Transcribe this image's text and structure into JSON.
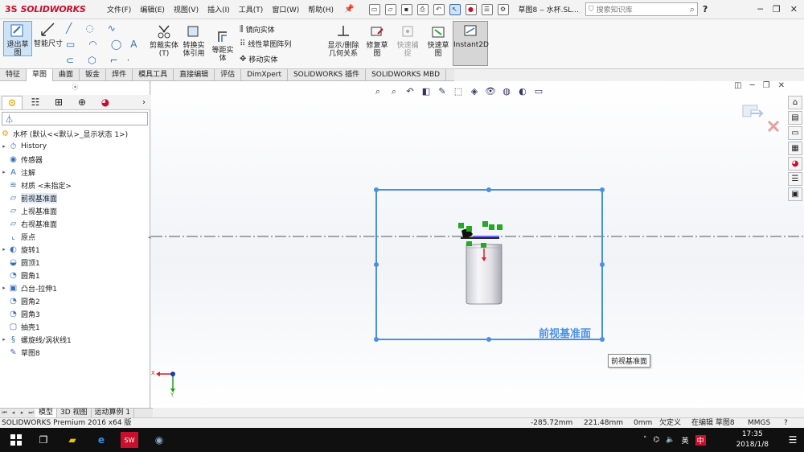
{
  "app": {
    "logo_ds": "3S",
    "logo_text": "SOLIDWORKS",
    "doc_title": "草图8 ‒ 水杯.SL...",
    "window_controls": [
      "─",
      "❐",
      "✕"
    ]
  },
  "menu": [
    "文件(F)",
    "编辑(E)",
    "视图(V)",
    "插入(I)",
    "工具(T)",
    "窗口(W)",
    "帮助(H)"
  ],
  "search": {
    "placeholder": "搜索知识库",
    "help": "?"
  },
  "ribbon": {
    "exit_sketch": "退出草图",
    "smart_dim": "智能尺寸",
    "trim": "剪裁实体(T)",
    "convert": "转换实体引用",
    "offset": "等距实体",
    "mirror": "镜向实体",
    "linear_pattern": "线性草图阵列",
    "move": "移动实体",
    "relations": "显示/删除几何关系",
    "repair": "修复草图",
    "quick_snap": "快速捕捉",
    "rapid_sketch": "快速草图",
    "instant2d": "Instant2D"
  },
  "tabs": [
    "特征",
    "草图",
    "曲面",
    "钣金",
    "焊件",
    "模具工具",
    "直接编辑",
    "评估",
    "DimXpert",
    "SOLIDWORKS 插件",
    "SOLIDWORKS MBD"
  ],
  "tree": {
    "root": "水杯 (默认<<默认>_显示状态 1>)",
    "items": [
      {
        "label": "History",
        "arrow": "▸",
        "icon": "⏱"
      },
      {
        "label": "传感器",
        "arrow": "",
        "icon": "◉"
      },
      {
        "label": "注解",
        "arrow": "▸",
        "icon": "A"
      },
      {
        "label": "材质 <未指定>",
        "arrow": "",
        "icon": "≋"
      },
      {
        "label": "前视基准面",
        "arrow": "",
        "icon": "▱"
      },
      {
        "label": "上视基准面",
        "arrow": "",
        "icon": "▱"
      },
      {
        "label": "右视基准面",
        "arrow": "",
        "icon": "▱"
      },
      {
        "label": "原点",
        "arrow": "",
        "icon": "⌞"
      },
      {
        "label": "旋转1",
        "arrow": "▸",
        "icon": "◐"
      },
      {
        "label": "圆顶1",
        "arrow": "",
        "icon": "◒"
      },
      {
        "label": "圆角1",
        "arrow": "",
        "icon": "◔"
      },
      {
        "label": "凸台-拉伸1",
        "arrow": "▸",
        "icon": "▣"
      },
      {
        "label": "圆角2",
        "arrow": "",
        "icon": "◔"
      },
      {
        "label": "圆角3",
        "arrow": "",
        "icon": "◔"
      },
      {
        "label": "抽壳1",
        "arrow": "",
        "icon": "▢"
      },
      {
        "label": "螺旋线/涡状线1",
        "arrow": "▸",
        "icon": "§"
      },
      {
        "label": "草图8",
        "arrow": "",
        "icon": "✎"
      }
    ]
  },
  "viewport": {
    "plane_label": "前视基准面",
    "tooltip": "前视基准面",
    "triad_x": "X",
    "triad_y": "Y"
  },
  "bottom_tabs": [
    "模型",
    "3D 视图",
    "运动算例 1"
  ],
  "status": {
    "product": "SOLIDWORKS Premium 2016 x64 版",
    "x": "-285.72mm",
    "y": "221.48mm",
    "z": "0mm",
    "state": "欠定义",
    "editing": "在编辑 草图8",
    "units": "MMGS"
  },
  "taskbar": {
    "time": "17:35",
    "date": "2018/1/8",
    "ime": "英",
    "ime2": "中"
  },
  "colors": {
    "accent": "#3a6fb5",
    "plane_blue": "#4a90e2",
    "brand_red": "#c8102e",
    "sel_green": "#22aa22"
  }
}
